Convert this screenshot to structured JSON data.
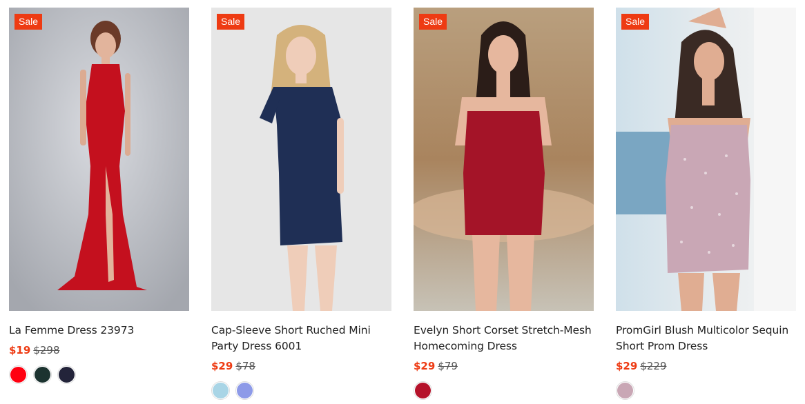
{
  "products": [
    {
      "badge": "Sale",
      "name": "La Femme Dress 23973",
      "price": "$19",
      "original_price": "$298",
      "swatches": [
        "#ff0010",
        "#1c3330",
        "#23243a"
      ]
    },
    {
      "badge": "Sale",
      "name": "Cap-Sleeve Short Ruched Mini Party Dress 6001",
      "price": "$29",
      "original_price": "$78",
      "swatches": [
        "#a9d5e6",
        "#8d9ae8"
      ]
    },
    {
      "badge": "Sale",
      "name": "Evelyn Short Corset Stretch-Mesh Homecoming Dress",
      "price": "$29",
      "original_price": "$79",
      "swatches": [
        "#b5122a"
      ]
    },
    {
      "badge": "Sale",
      "name": "PromGirl Blush Multicolor Sequin Short Prom Dress",
      "price": "$29",
      "original_price": "$229",
      "swatches": [
        "#c9a7b5"
      ]
    }
  ]
}
